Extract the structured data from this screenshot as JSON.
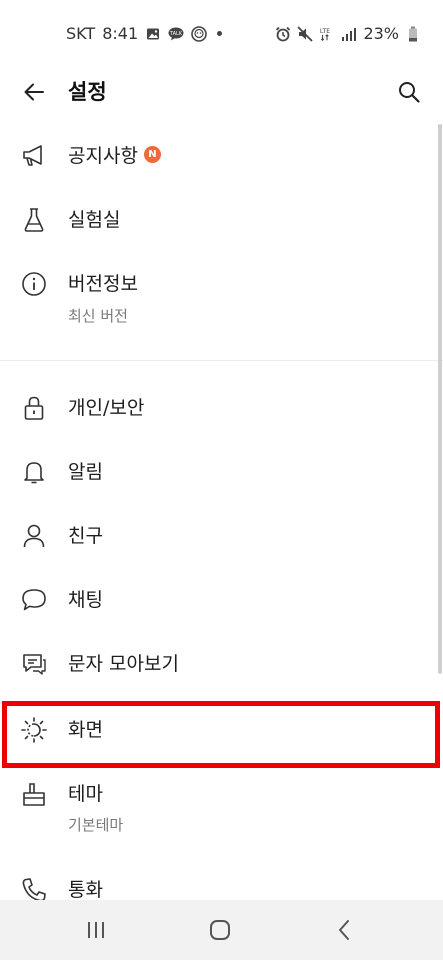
{
  "status_bar": {
    "carrier": "SKT",
    "time": "8:41",
    "left_icons": [
      "gallery-icon",
      "talk-icon",
      "bot-icon",
      "dot"
    ],
    "right_icons": [
      "alarm-icon",
      "mute-icon",
      "lte-icon",
      "signal-icon"
    ],
    "network": "LTE",
    "battery": "23%"
  },
  "app_bar": {
    "title": "설정",
    "back_icon": "arrow-left-icon",
    "search_icon": "search-icon"
  },
  "settings": {
    "items": [
      {
        "label": "공지사항",
        "icon": "megaphone-icon",
        "badge": "N"
      },
      {
        "label": "실험실",
        "icon": "flask-icon"
      },
      {
        "label": "버전정보",
        "icon": "info-icon",
        "sub": "최신 버전"
      },
      {
        "label": "개인/보안",
        "icon": "lock-icon"
      },
      {
        "label": "알림",
        "icon": "bell-icon"
      },
      {
        "label": "친구",
        "icon": "person-icon"
      },
      {
        "label": "채팅",
        "icon": "chat-bubble-icon"
      },
      {
        "label": "문자 모아보기",
        "icon": "message-icon"
      },
      {
        "label": "화면",
        "icon": "brightness-icon",
        "highlighted": true
      },
      {
        "label": "테마",
        "icon": "theme-brush-icon",
        "sub": "기본테마"
      },
      {
        "label": "통화",
        "icon": "phone-icon"
      }
    ]
  },
  "colors": {
    "badge": "#f06a3a",
    "highlight_border": "#ee0000",
    "subtext": "#7b7b7b"
  },
  "nav_bar": {
    "icons": [
      "recent-apps-icon",
      "home-icon",
      "back-nav-icon"
    ]
  }
}
